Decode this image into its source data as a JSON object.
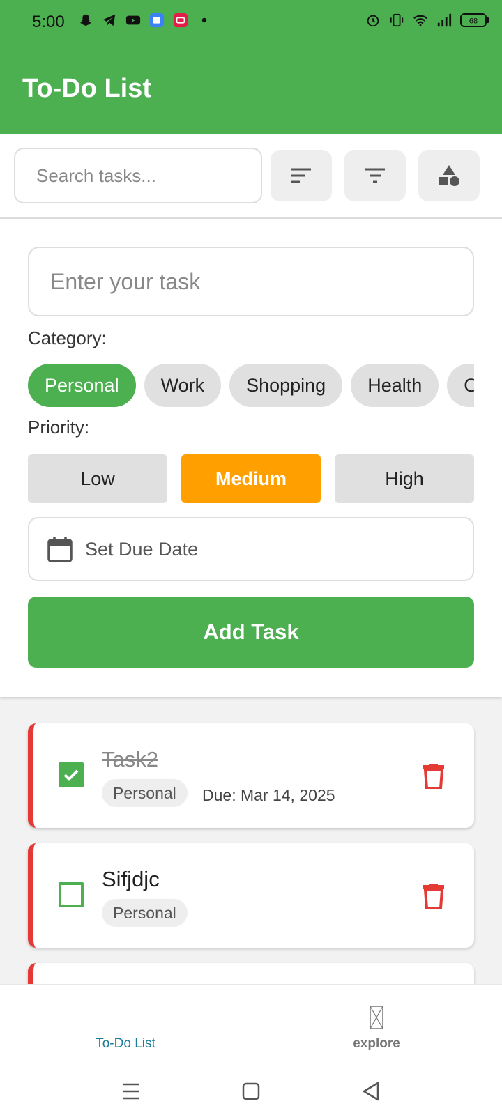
{
  "status_bar": {
    "time": "5:00",
    "battery": "68",
    "left_icons": [
      "snapchat-icon",
      "telegram-icon",
      "youtube-icon",
      "app-icon",
      "screen-record-icon",
      "dot-icon"
    ],
    "right_icons": [
      "alarm-icon",
      "vibrate-icon",
      "wifi-icon",
      "signal-icon",
      "battery-icon"
    ]
  },
  "header": {
    "title": "To-Do List"
  },
  "search": {
    "placeholder": "Search tasks...",
    "tools": [
      "sort-icon",
      "filter-icon",
      "category-shapes-icon"
    ]
  },
  "form": {
    "task_placeholder": "Enter your task",
    "category_label": "Category:",
    "categories": [
      "Personal",
      "Work",
      "Shopping",
      "Health",
      "Other"
    ],
    "selected_category": "Personal",
    "priority_label": "Priority:",
    "priorities": [
      "Low",
      "Medium",
      "High"
    ],
    "selected_priority": "Medium",
    "due_date_label": "Set Due Date",
    "add_button": "Add Task"
  },
  "tasks": [
    {
      "title": "Task2",
      "completed": true,
      "category": "Personal",
      "due": "Due: Mar 14, 2025"
    },
    {
      "title": "Sifjdjc",
      "completed": false,
      "category": "Personal",
      "due": ""
    },
    {
      "title": "",
      "completed": false,
      "category": "",
      "due": ""
    }
  ],
  "bottom_nav": {
    "items": [
      {
        "label": "To-Do List",
        "active": true
      },
      {
        "label": "explore",
        "active": false
      }
    ]
  },
  "colors": {
    "primary": "#4caf50",
    "medium_priority": "#ffa000",
    "high_priority_border": "#e53935",
    "delete": "#e53935",
    "nav_active": "#1a7a9a"
  }
}
